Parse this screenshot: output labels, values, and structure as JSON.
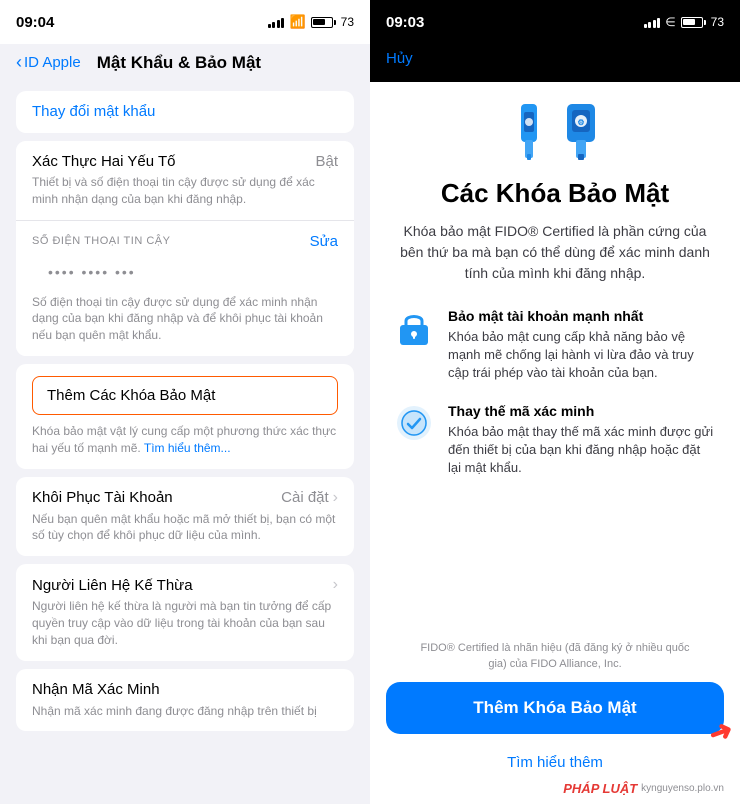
{
  "left": {
    "statusBar": {
      "time": "09:04",
      "battery": "73"
    },
    "nav": {
      "backLabel": "ID Apple",
      "title": "Mật Khẩu & Bảo Mật"
    },
    "sections": {
      "changePassword": {
        "label": "Thay đổi mật khẩu"
      },
      "twoFactor": {
        "title": "Xác Thực Hai Yếu Tố",
        "value": "Bật",
        "description": "Thiết bị và số điện thoại tin cậy được sử dụng để xác minh nhận dạng của bạn khi đăng nhập."
      },
      "trustedPhone": {
        "sectionLabel": "SỐ ĐIỆN THOẠI TIN CẬY",
        "editLabel": "Sửa",
        "phoneValue": "•••• •••• •••",
        "phoneDescription": "Số điện thoại tin cậy được sử dụng để xác minh nhận dạng của bạn khi đăng nhập và để khôi phục tài khoản nếu bạn quên mật khẩu."
      },
      "addSecurityKey": {
        "label": "Thêm Các Khóa Bảo Mật",
        "description": "Khóa bảo mật vật lý cung cấp một phương thức xác thực hai yếu tố mạnh mẽ.",
        "learnMore": "Tìm hiểu thêm..."
      },
      "accountRecovery": {
        "title": "Khôi Phục Tài Khoản",
        "value": "Cài đặt"
      },
      "accountRecoveryDesc": "Nếu bạn quên mật khẩu hoặc mã mở thiết bị, bạn có một số tùy chọn để khôi phục dữ liệu của mình.",
      "legacyContact": {
        "title": "Người Liên Hệ Kế Thừa",
        "description": "Người liên hệ kế thừa là người mà bạn tin tưởng để cấp quyền truy cập vào dữ liệu trong tài khoản của bạn sau khi bạn qua đời."
      },
      "verificationCode": {
        "title": "Nhận Mã Xác Minh",
        "description": "Nhận mã xác minh đang được đăng nhập trên thiết bị"
      }
    }
  },
  "right": {
    "statusBar": {
      "time": "09:03",
      "battery": "73"
    },
    "nav": {
      "cancelLabel": "Hủy"
    },
    "title": "Các Khóa Bảo Mật",
    "description": "Khóa bảo mật FIDO® Certified là phần cứng của bên thứ ba mà bạn có thể dùng để xác minh danh tính của mình khi đăng nhập.",
    "features": [
      {
        "icon": "lock",
        "title": "Bảo mật tài khoản mạnh nhất",
        "description": "Khóa bảo mật cung cấp khả năng bảo vệ mạnh mẽ chống lại hành vi lừa đảo và truy cập trái phép vào tài khoản của bạn."
      },
      {
        "icon": "shield-check",
        "title": "Thay thế mã xác minh",
        "description": "Khóa bảo mật thay thế mã xác minh được gửi đến thiết bị của bạn khi đăng nhập hoặc đặt lại mật khẩu."
      }
    ],
    "footerNote": "FIDO® Certified là nhãn hiệu (đã đăng ký ở nhiều quốc gia) của FIDO Alliance, Inc.",
    "addButton": "Thêm Khóa Bảo Mật",
    "learnMore": "Tìm hiểu thêm",
    "watermark": {
      "brand": "PHÁP LUẬT",
      "site": "kynguyenso.plo.vn"
    }
  }
}
